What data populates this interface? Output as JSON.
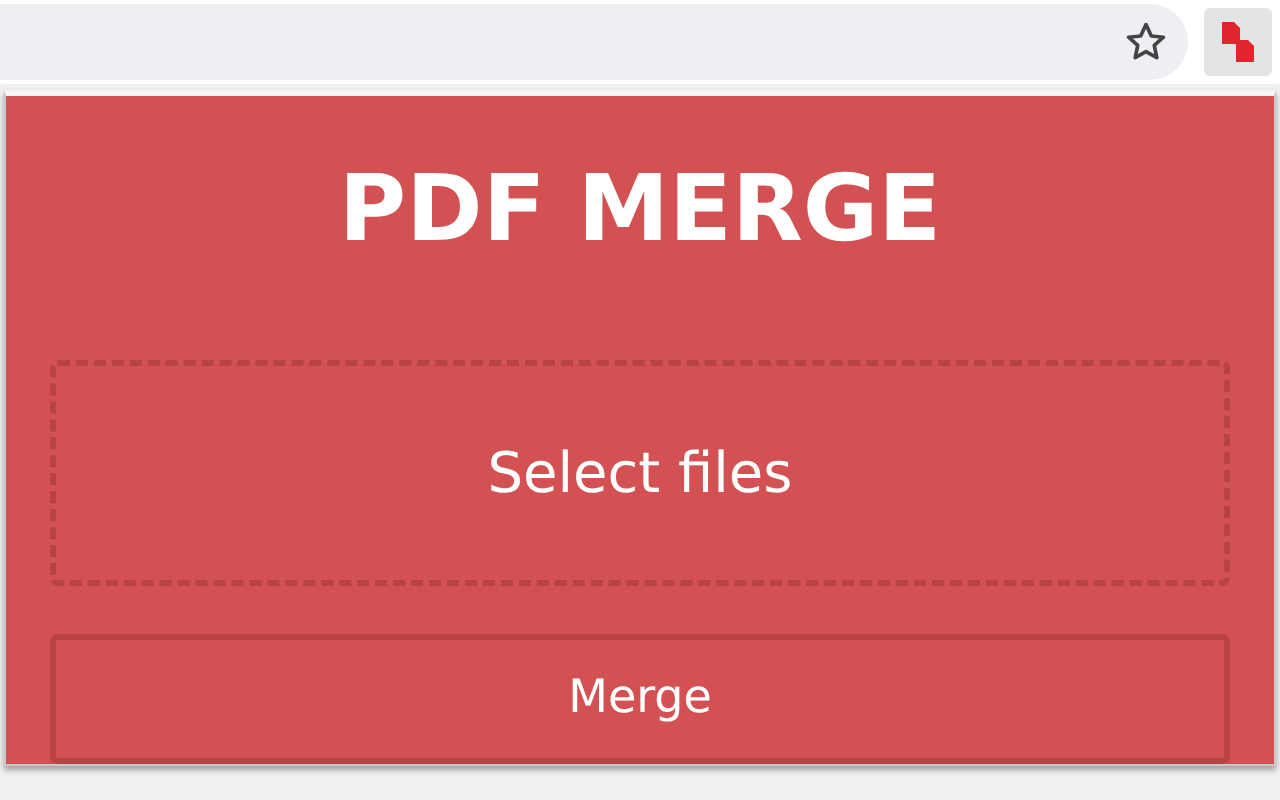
{
  "popup": {
    "title": "PDF MERGE",
    "drop_zone": {
      "label": "Select files"
    },
    "buttons": [
      {
        "label": "Merge"
      }
    ]
  }
}
